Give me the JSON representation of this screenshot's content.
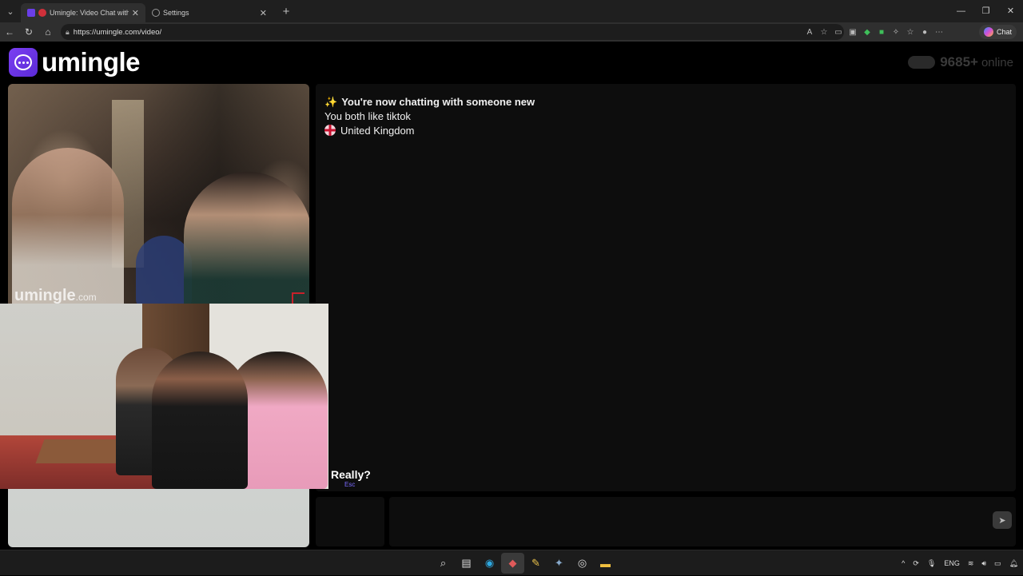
{
  "browser": {
    "tabs": [
      {
        "title": "Umingle: Video Chat with Str",
        "active": true
      },
      {
        "title": "Settings",
        "active": false
      }
    ],
    "url": "https://umingle.com/video/",
    "chat_button": "Chat"
  },
  "site": {
    "logo_text": "umingle",
    "online_count": "9685+",
    "online_label": "online"
  },
  "video": {
    "watermark_main": "umingle",
    "watermark_suffix": ".com"
  },
  "chat": {
    "messages": [
      {
        "text": "You're now chatting with someone new",
        "icon": "sparkle-icon"
      },
      {
        "text": "You both like tiktok"
      },
      {
        "text": "United Kingdom",
        "icon": "uk-flag-icon"
      }
    ]
  },
  "controls": {
    "stop_label": "Really?",
    "esc_hint": "Esc"
  },
  "taskbar": {
    "lang": "ENG"
  }
}
